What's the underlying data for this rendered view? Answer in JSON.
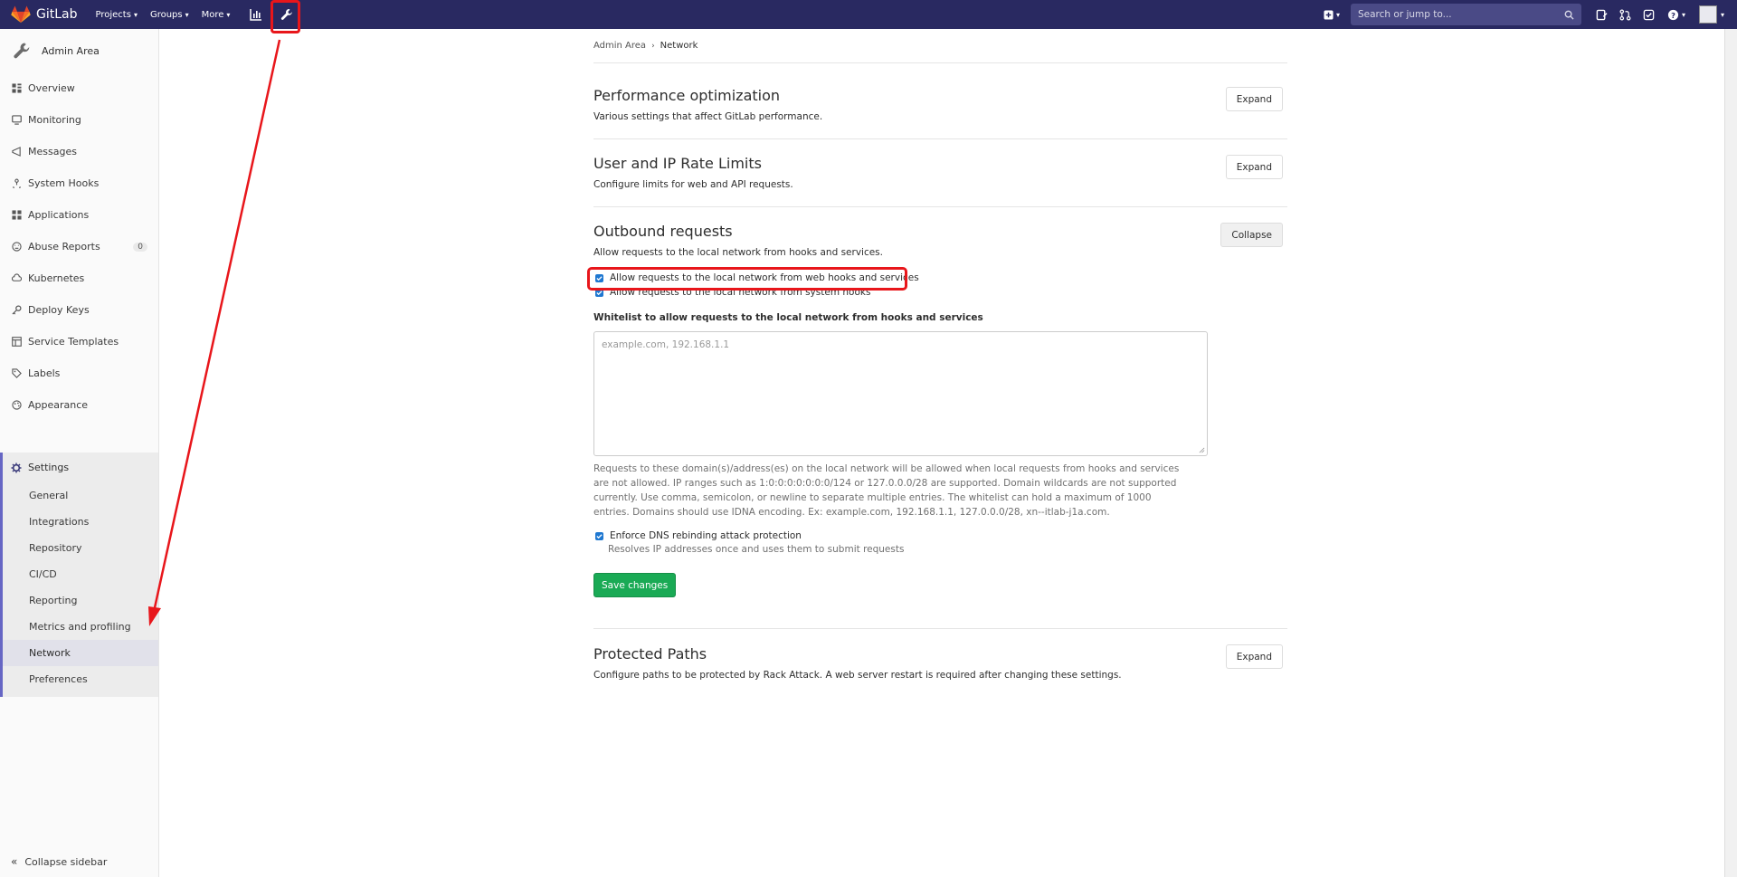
{
  "navbar": {
    "logo_text": "GitLab",
    "links": [
      {
        "label": "Projects"
      },
      {
        "label": "Groups"
      },
      {
        "label": "More"
      }
    ],
    "search_placeholder": "Search or jump to...",
    "highlight_color": "#e8161b"
  },
  "sidebar": {
    "header": "Admin Area",
    "items": [
      {
        "label": "Overview",
        "icon": "overview-icon"
      },
      {
        "label": "Monitoring",
        "icon": "monitor-icon"
      },
      {
        "label": "Messages",
        "icon": "messages-icon"
      },
      {
        "label": "System Hooks",
        "icon": "hook-icon"
      },
      {
        "label": "Applications",
        "icon": "applications-icon"
      },
      {
        "label": "Abuse Reports",
        "icon": "abuse-icon",
        "badge": "0"
      },
      {
        "label": "Kubernetes",
        "icon": "kubernetes-icon"
      },
      {
        "label": "Deploy Keys",
        "icon": "key-icon"
      },
      {
        "label": "Service Templates",
        "icon": "template-icon"
      },
      {
        "label": "Labels",
        "icon": "label-icon"
      },
      {
        "label": "Appearance",
        "icon": "appearance-icon"
      }
    ],
    "settings": {
      "title": "Settings",
      "sub_items": [
        "General",
        "Integrations",
        "Repository",
        "CI/CD",
        "Reporting",
        "Metrics and profiling",
        "Network",
        "Preferences"
      ],
      "active": "Network"
    },
    "collapse_label": "Collapse sidebar"
  },
  "breadcrumb": {
    "parent": "Admin Area",
    "current": "Network"
  },
  "sections": {
    "performance": {
      "title": "Performance optimization",
      "desc": "Various settings that affect GitLab performance.",
      "button": "Expand"
    },
    "rate_limits": {
      "title": "User and IP Rate Limits",
      "desc": "Configure limits for web and API requests.",
      "button": "Expand"
    },
    "outbound": {
      "title": "Outbound requests",
      "desc": "Allow requests to the local network from hooks and services.",
      "button": "Collapse",
      "checkbox_web_hooks": "Allow requests to the local network from web hooks and services",
      "checkbox_web_hooks_checked": true,
      "checkbox_system_hooks": "Allow requests to the local network from system hooks",
      "checkbox_system_hooks_checked": true,
      "whitelist_label": "Whitelist to allow requests to the local network from hooks and services",
      "whitelist_placeholder": "example.com, 192.168.1.1",
      "whitelist_value": "",
      "help_text": "Requests to these domain(s)/address(es) on the local network will be allowed when local requests from hooks and services are not allowed. IP ranges such as 1:0:0:0:0:0:0:0/124 or 127.0.0.0/28 are supported. Domain wildcards are not supported currently. Use comma, semicolon, or newline to separate multiple entries. The whitelist can hold a maximum of 1000 entries. Domains should use IDNA encoding. Ex: example.com, 192.168.1.1, 127.0.0.0/28, xn--itlab-j1a.com.",
      "dns_label": "Enforce DNS rebinding attack protection",
      "dns_checked": true,
      "dns_help": "Resolves IP addresses once and uses them to submit requests",
      "save_button": "Save changes"
    },
    "protected_paths": {
      "title": "Protected Paths",
      "desc": "Configure paths to be protected by Rack Attack. A web server restart is required after changing these settings.",
      "button": "Expand"
    }
  }
}
